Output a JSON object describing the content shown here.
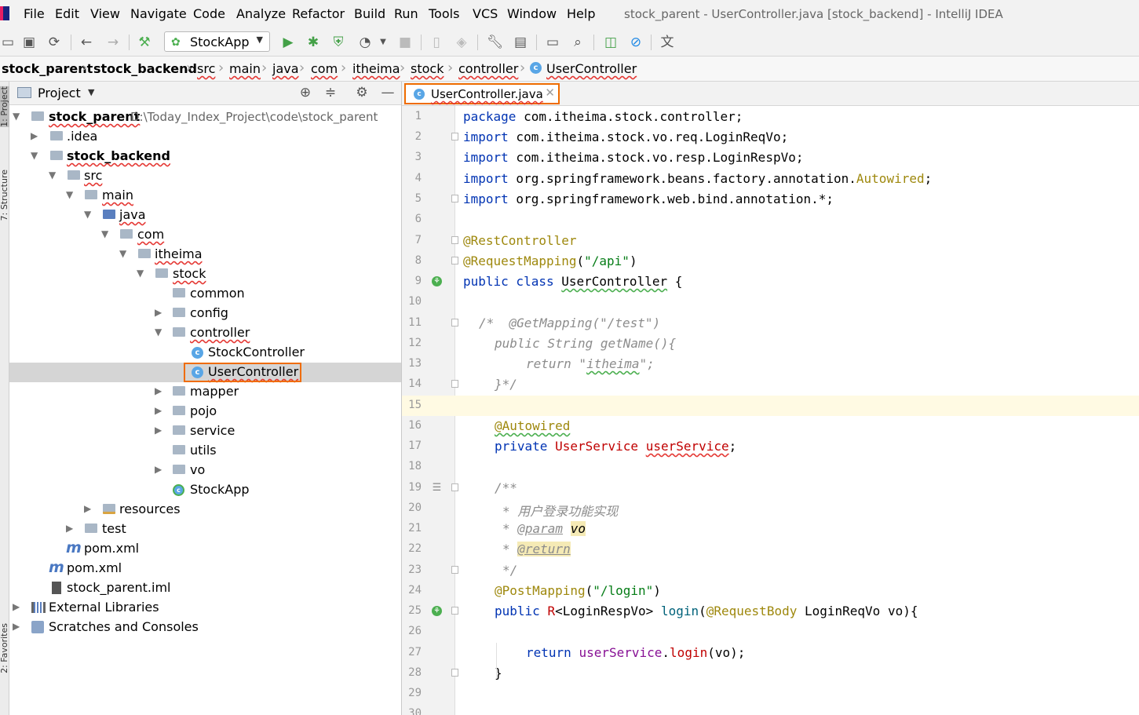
{
  "menubar": {
    "items": [
      "File",
      "Edit",
      "View",
      "Navigate",
      "Code",
      "Analyze",
      "Refactor",
      "Build",
      "Run",
      "Tools",
      "VCS",
      "Window",
      "Help"
    ],
    "window_title": "stock_parent - UserController.java [stock_backend] - IntelliJ IDEA"
  },
  "toolbar": {
    "run_config": "StockApp"
  },
  "breadcrumbs": [
    "stock_parent",
    "stock_backend",
    "src",
    "main",
    "java",
    "com",
    "itheima",
    "stock",
    "controller",
    "UserController"
  ],
  "side_tabs": [
    "1: Project",
    "7: Structure",
    "2: Favorites"
  ],
  "project_panel": {
    "title": "Project",
    "tree": [
      {
        "label": "stock_parent",
        "path": "D:\\Today_Index_Project\\code\\stock_parent"
      },
      {
        "label": ".idea"
      },
      {
        "label": "stock_backend"
      },
      {
        "label": "src"
      },
      {
        "label": "main"
      },
      {
        "label": "java"
      },
      {
        "label": "com"
      },
      {
        "label": "itheima"
      },
      {
        "label": "stock"
      },
      {
        "label": "common"
      },
      {
        "label": "config"
      },
      {
        "label": "controller"
      },
      {
        "label": "StockController"
      },
      {
        "label": "UserController"
      },
      {
        "label": "mapper"
      },
      {
        "label": "pojo"
      },
      {
        "label": "service"
      },
      {
        "label": "utils"
      },
      {
        "label": "vo"
      },
      {
        "label": "StockApp"
      },
      {
        "label": "resources"
      },
      {
        "label": "test"
      },
      {
        "label": "pom.xml"
      },
      {
        "label": "pom.xml"
      },
      {
        "label": "stock_parent.iml"
      },
      {
        "label": "External Libraries"
      },
      {
        "label": "Scratches and Consoles"
      }
    ]
  },
  "editor": {
    "tab_label": "UserController.java",
    "line_numbers": [
      "1",
      "2",
      "3",
      "4",
      "5",
      "6",
      "7",
      "8",
      "9",
      "10",
      "11",
      "12",
      "13",
      "14",
      "15",
      "16",
      "17",
      "18",
      "19",
      "20",
      "21",
      "22",
      "23",
      "24",
      "25",
      "26",
      "27",
      "28",
      "29",
      "30"
    ],
    "code": {
      "l1a": "package",
      "l1b": " com.itheima.stock.controller;",
      "l2a": "import",
      "l2b": " com.itheima.stock.vo.req.LoginReqVo;",
      "l3a": "import",
      "l3b": " com.itheima.stock.vo.resp.LoginRespVo;",
      "l4a": "import",
      "l4b": " org.springframework.beans.factory.annotation.",
      "l4c": "Autowired",
      "l4d": ";",
      "l5a": "import",
      "l5b": " org.springframework.web.bind.annotation.*;",
      "l7": "@RestController",
      "l8a": "@RequestMapping",
      "l8b": "(",
      "l8c": "\"/api\"",
      "l8d": ")",
      "l9a": "public class",
      "l9b": " ",
      "l9c": "UserController",
      "l9d": " {",
      "l11a": "/*  @GetMapping(\"/test\")",
      "l12": "public String getName(){",
      "l13a": "return \"",
      "l13b": "itheima",
      "l13c": "\";",
      "l14": "}*/",
      "l16": "@Autowired",
      "l17a": "private",
      "l17b": " ",
      "l17c": "UserService",
      "l17d": " ",
      "l17e": "userService",
      "l17f": ";",
      "l19": "/**",
      "l20": "* 用户登录功能实现",
      "l21a": "* ",
      "l21b": "@param",
      "l21c": " ",
      "l21d": "vo",
      "l22a": "* ",
      "l22b": "@return",
      "l23": "*/",
      "l24a": "@PostMapping",
      "l24b": "(",
      "l24c": "\"/login\"",
      "l24d": ")",
      "l25a": "public",
      "l25b": " ",
      "l25c": "R",
      "l25d": "<LoginRespVo> ",
      "l25e": "login",
      "l25f": "(",
      "l25g": "@RequestBody",
      "l25h": " LoginReqVo vo){",
      "l27a": "return",
      "l27b": " ",
      "l27c": "userService",
      "l27d": ".",
      "l27e": "login",
      "l27f": "(vo);",
      "l28": "}"
    }
  }
}
